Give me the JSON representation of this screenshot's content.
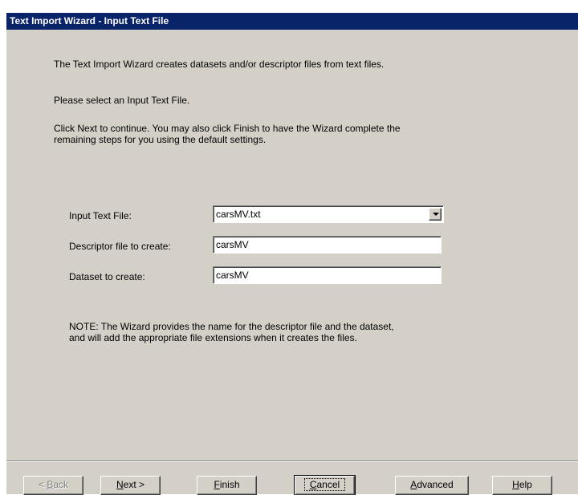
{
  "window": {
    "title": "Text Import Wizard - Input Text File"
  },
  "intro": {
    "line1": "The Text Import Wizard creates datasets and/or descriptor files from text files.",
    "line2": "Please select an Input Text File.",
    "line3": "Click Next to continue.  You may also click Finish to have the Wizard complete the\nremaining steps for you using the default settings."
  },
  "form": {
    "input_file_label": "Input Text File:",
    "input_file_value": "carsMV.txt",
    "descriptor_label": "Descriptor file to create:",
    "descriptor_value": "carsMV",
    "dataset_label": "Dataset to create:",
    "dataset_value": "carsMV"
  },
  "note": "NOTE: The Wizard provides the name for the descriptor file and the dataset,\nand will add the appropriate file extensions when it creates the files.",
  "buttons": {
    "back": {
      "mnemonic": "B",
      "rest": "ack",
      "prefix": "< ",
      "enabled": false
    },
    "next": {
      "mnemonic": "N",
      "rest": "ext >"
    },
    "finish": {
      "mnemonic": "F",
      "rest": "inish"
    },
    "cancel": {
      "mnemonic": "C",
      "rest": "ancel"
    },
    "advanced": {
      "mnemonic": "A",
      "rest": "dvanced"
    },
    "help": {
      "mnemonic": "H",
      "rest": "elp"
    }
  }
}
